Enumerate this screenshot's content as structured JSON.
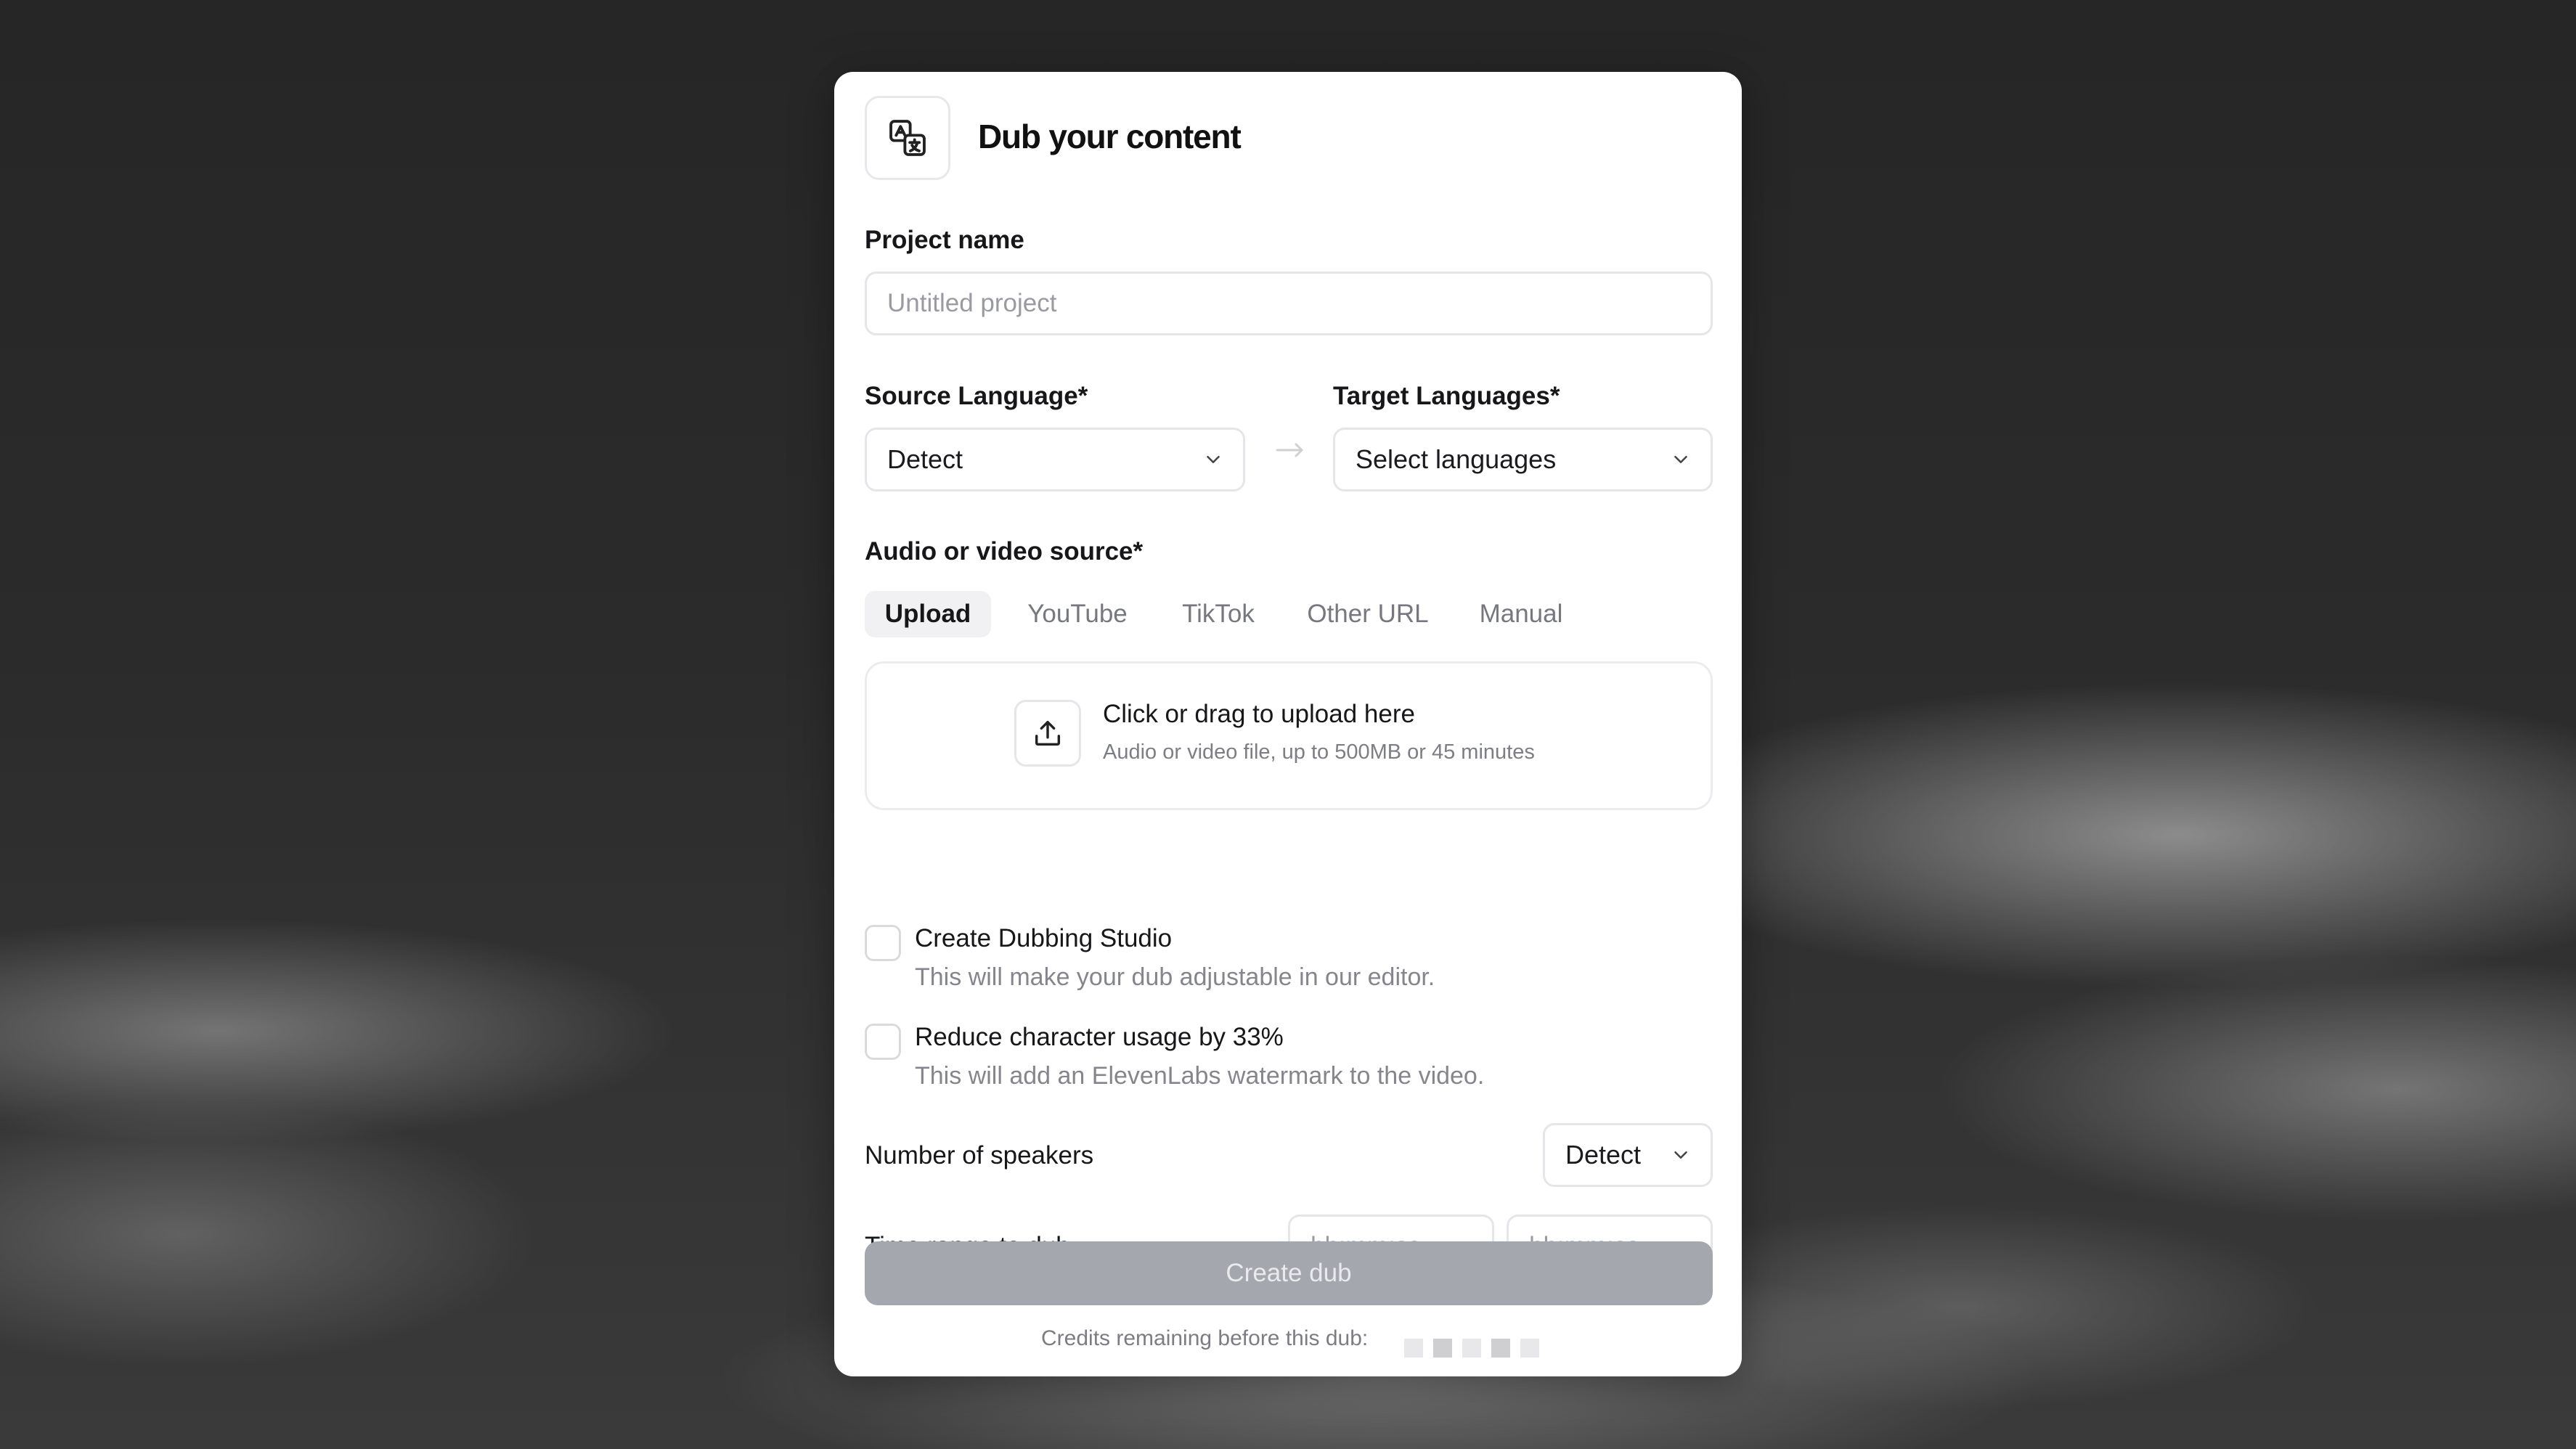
{
  "header": {
    "title": "Dub your content",
    "logo_icon": "translate-icon"
  },
  "project": {
    "label": "Project name",
    "placeholder": "Untitled project",
    "value": ""
  },
  "languages": {
    "source_label": "Source Language*",
    "source_value": "Detect",
    "target_label": "Target Languages*",
    "target_value": "Select languages"
  },
  "source": {
    "label": "Audio or video source*",
    "tabs": [
      {
        "label": "Upload",
        "active": true
      },
      {
        "label": "YouTube",
        "active": false
      },
      {
        "label": "TikTok",
        "active": false
      },
      {
        "label": "Other URL",
        "active": false
      },
      {
        "label": "Manual",
        "active": false
      }
    ]
  },
  "upload": {
    "title": "Click or drag to upload here",
    "subtitle": "Audio or video file, up to 500MB or 45 minutes"
  },
  "options": {
    "studio_title": "Create Dubbing Studio",
    "studio_desc": "This will make your dub adjustable in our editor.",
    "studio_checked": false,
    "watermark_title": "Reduce character usage by 33%",
    "watermark_desc": "This will add an ElevenLabs watermark to the video.",
    "watermark_checked": false
  },
  "speakers": {
    "label": "Number of speakers",
    "value": "Detect"
  },
  "time_range": {
    "label": "Time range to dub",
    "start_placeholder": "hh:mm:ss",
    "end_placeholder": "hh:mm:ss"
  },
  "actions": {
    "create_label": "Create dub",
    "create_disabled": true
  },
  "footer": {
    "credits_label": "Credits remaining before this dub:"
  },
  "colors": {
    "card_bg": "#ffffff",
    "button_disabled": "#a4a7ae",
    "active_tab_bg": "#f1f1f3"
  }
}
